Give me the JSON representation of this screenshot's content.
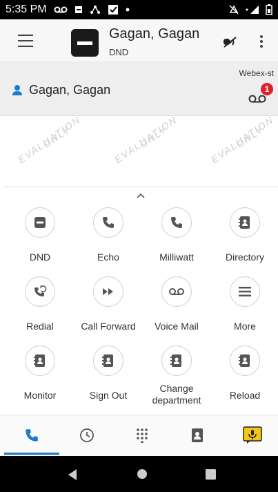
{
  "status_bar": {
    "time": "5:35 PM"
  },
  "header": {
    "title": "Gagan, Gagan",
    "subtitle": "DND"
  },
  "contact": {
    "name": "Gagan, Gagan",
    "service": "Webex-st",
    "voicemail_count": "1"
  },
  "watermark_text": [
    "EVALUATION",
    "ONLY"
  ],
  "actions": [
    {
      "label": "DND",
      "icon": "dnd-icon"
    },
    {
      "label": "Echo",
      "icon": "phone-icon"
    },
    {
      "label": "Milliwatt",
      "icon": "phone-icon"
    },
    {
      "label": "Directory",
      "icon": "directory-icon"
    },
    {
      "label": "Redial",
      "icon": "redial-icon"
    },
    {
      "label": "Call Forward",
      "icon": "forward-icon"
    },
    {
      "label": "Voice Mail",
      "icon": "voicemail-icon"
    },
    {
      "label": "More",
      "icon": "more-menu-icon"
    },
    {
      "label": "Monitor",
      "icon": "directory-icon"
    },
    {
      "label": "Sign Out",
      "icon": "directory-icon"
    },
    {
      "label": "Change department",
      "icon": "directory-icon"
    },
    {
      "label": "Reload",
      "icon": "directory-icon"
    }
  ],
  "tabs": [
    "phone-icon",
    "clock-icon",
    "dialpad-icon",
    "contacts-icon",
    "voicemail-message-icon"
  ],
  "colors": {
    "accent": "#1a7bd1",
    "badge": "#e0202a",
    "chat_tab": "#f5c518"
  }
}
